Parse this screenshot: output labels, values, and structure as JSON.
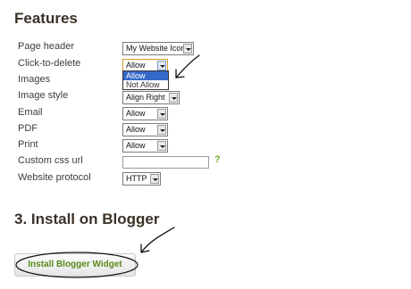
{
  "features": {
    "title": "Features",
    "rows": [
      {
        "label": "Page header",
        "value": "My Website Icon"
      },
      {
        "label": "Click-to-delete",
        "value": "Allow"
      },
      {
        "label": "Images"
      },
      {
        "label": "Image style",
        "value": "Align Right"
      },
      {
        "label": "Email",
        "value": "Allow"
      },
      {
        "label": "PDF",
        "value": "Allow"
      },
      {
        "label": "Print",
        "value": "Allow"
      },
      {
        "label": "Custom css url",
        "value": ""
      },
      {
        "label": "Website protocol",
        "value": "HTTP"
      }
    ],
    "click_to_delete_options": [
      "Allow",
      "Not Allow"
    ],
    "css_help": "?"
  },
  "install": {
    "title": "3. Install on Blogger",
    "button_label": "Install Blogger Widget"
  },
  "colors": {
    "help_link": "#6aa81f",
    "button_text": "#57891a",
    "highlight": "#3569c8"
  }
}
